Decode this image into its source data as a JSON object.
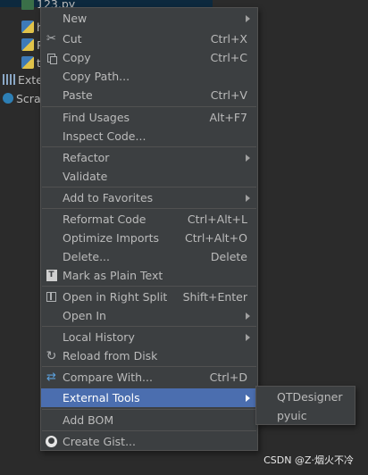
{
  "tree": {
    "rows": [
      {
        "label": "123.py",
        "icon": "folder-icon"
      },
      {
        "label": "h",
        "icon": "python-file-icon"
      },
      {
        "label": "P",
        "icon": "python-file-icon"
      },
      {
        "label": "t",
        "icon": "python-file-icon"
      },
      {
        "label": "Exte",
        "icon": "external-libraries-icon"
      },
      {
        "label": "Scra",
        "icon": "scratches-icon"
      }
    ]
  },
  "menu": {
    "items": [
      {
        "id": "new",
        "label": "New",
        "shortcut": "",
        "submenu": true,
        "icon": ""
      },
      {
        "id": "cut",
        "label": "Cut",
        "shortcut": "Ctrl+X",
        "submenu": false,
        "icon": "scissors-icon"
      },
      {
        "id": "copy",
        "label": "Copy",
        "shortcut": "Ctrl+C",
        "submenu": false,
        "icon": "copy-icon"
      },
      {
        "id": "copy-path",
        "label": "Copy Path...",
        "shortcut": "",
        "submenu": false,
        "icon": ""
      },
      {
        "id": "paste",
        "label": "Paste",
        "shortcut": "Ctrl+V",
        "submenu": false,
        "icon": "paste-icon"
      },
      {
        "id": "find-usages",
        "label": "Find Usages",
        "shortcut": "Alt+F7",
        "submenu": false,
        "icon": ""
      },
      {
        "id": "inspect-code",
        "label": "Inspect Code...",
        "shortcut": "",
        "submenu": false,
        "icon": ""
      },
      {
        "id": "refactor",
        "label": "Refactor",
        "shortcut": "",
        "submenu": true,
        "icon": ""
      },
      {
        "id": "validate",
        "label": "Validate",
        "shortcut": "",
        "submenu": false,
        "icon": ""
      },
      {
        "id": "add-to-favorites",
        "label": "Add to Favorites",
        "shortcut": "",
        "submenu": true,
        "icon": ""
      },
      {
        "id": "reformat-code",
        "label": "Reformat Code",
        "shortcut": "Ctrl+Alt+L",
        "submenu": false,
        "icon": ""
      },
      {
        "id": "optimize-imports",
        "label": "Optimize Imports",
        "shortcut": "Ctrl+Alt+O",
        "submenu": false,
        "icon": ""
      },
      {
        "id": "delete",
        "label": "Delete...",
        "shortcut": "Delete",
        "submenu": false,
        "icon": ""
      },
      {
        "id": "mark-as-plain-text",
        "label": "Mark as Plain Text",
        "shortcut": "",
        "submenu": false,
        "icon": "plain-text-icon"
      },
      {
        "id": "open-in-right-split",
        "label": "Open in Right Split",
        "shortcut": "Shift+Enter",
        "submenu": false,
        "icon": "split-icon"
      },
      {
        "id": "open-in",
        "label": "Open In",
        "shortcut": "",
        "submenu": true,
        "icon": ""
      },
      {
        "id": "local-history",
        "label": "Local History",
        "shortcut": "",
        "submenu": true,
        "icon": ""
      },
      {
        "id": "reload-from-disk",
        "label": "Reload from Disk",
        "shortcut": "",
        "submenu": false,
        "icon": "reload-icon"
      },
      {
        "id": "compare-with",
        "label": "Compare With...",
        "shortcut": "Ctrl+D",
        "submenu": false,
        "icon": "compare-icon"
      },
      {
        "id": "external-tools",
        "label": "External Tools",
        "shortcut": "",
        "submenu": true,
        "icon": ""
      },
      {
        "id": "add-bom",
        "label": "Add BOM",
        "shortcut": "",
        "submenu": false,
        "icon": ""
      },
      {
        "id": "create-gist",
        "label": "Create Gist...",
        "shortcut": "",
        "submenu": false,
        "icon": "github-icon"
      }
    ],
    "hovered": "external-tools"
  },
  "submenu": {
    "items": [
      {
        "label": "QTDesigner"
      },
      {
        "label": "pyuic"
      }
    ]
  },
  "watermark": "CSDN @Z·烟火不冷",
  "colors": {
    "menu_bg": "#3c3f41",
    "hover_bg": "#4b6eaf",
    "separator": "#515151",
    "text": "#bbbbbb"
  }
}
